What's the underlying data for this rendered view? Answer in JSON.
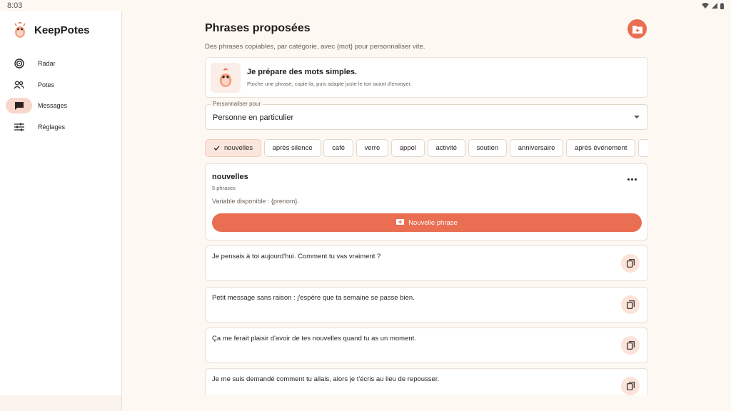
{
  "status": {
    "time": "8:03"
  },
  "app": {
    "name": "KeepPotes"
  },
  "nav": {
    "items": [
      {
        "label": "Radar"
      },
      {
        "label": "Potes"
      },
      {
        "label": "Messages"
      },
      {
        "label": "Réglages"
      }
    ]
  },
  "page": {
    "title": "Phrases proposées",
    "subtitle": "Des phrases copiables, par catégorie, avec {mot} pour personnaliser vite."
  },
  "intro": {
    "title": "Je prépare des mots simples.",
    "text": "Pioche une phrase, copie-la, puis adapte juste le ton avant d'envoyer."
  },
  "personalize": {
    "label": "Personnaliser pour",
    "value": "Personne en particulier"
  },
  "chips": [
    {
      "label": "nouvelles",
      "selected": true
    },
    {
      "label": "après silence"
    },
    {
      "label": "café"
    },
    {
      "label": "verre"
    },
    {
      "label": "appel"
    },
    {
      "label": "activité"
    },
    {
      "label": "soutien"
    },
    {
      "label": "anniversaire"
    },
    {
      "label": "après événement"
    }
  ],
  "category": {
    "title": "nouvelles",
    "count": "5 phrases",
    "variable": "Variable disponible : {prenom}.",
    "new_button": "Nouvelle phrase"
  },
  "phrases": [
    "Je pensais à toi aujourd'hui. Comment tu vas vraiment ?",
    "Petit message sans raison : j'espère que ta semaine se passe bien.",
    "Ça me ferait plaisir d'avoir de tes nouvelles quand tu as un moment.",
    "Je me suis demandé comment tu allais, alors je t'écris au lieu de repousser."
  ],
  "colors": {
    "accent": "#e96e52",
    "accent_soft": "#fbe3da",
    "background": "#fdf8f2"
  },
  "icons": {
    "nav": [
      "radar-icon",
      "people-icon",
      "chat-icon",
      "tune-icon"
    ],
    "fab": "add-folder-icon",
    "copy": "copy-icon",
    "more": "more-horizontal-icon",
    "chip_check": "check-icon"
  }
}
